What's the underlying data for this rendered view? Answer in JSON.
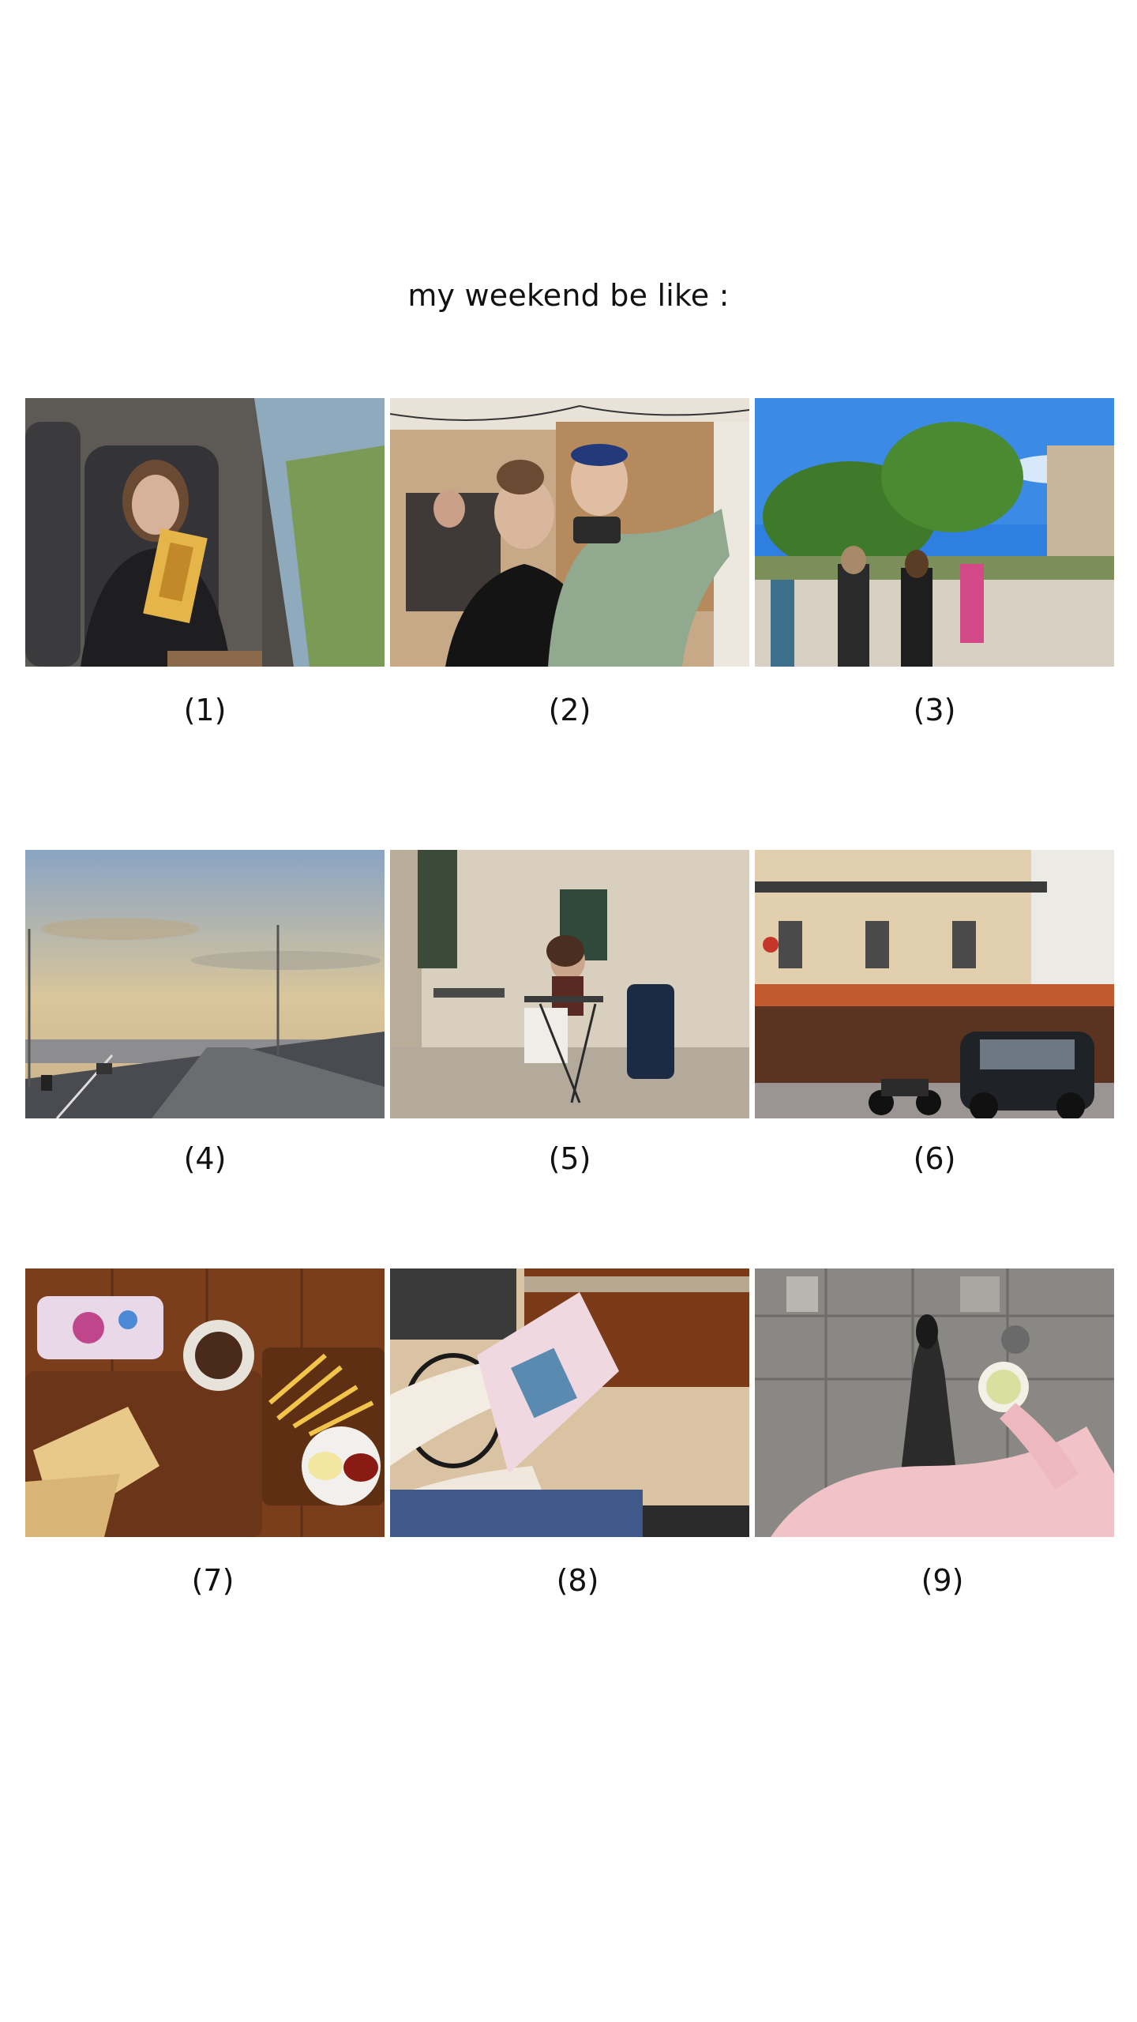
{
  "title": "my weekend be like :",
  "photos": [
    {
      "caption": "(1)",
      "subject": "girl reading a yellow book on a train seat by the window"
    },
    {
      "caption": "(2)",
      "subject": "two girls taking a mirror selfie in a cafe"
    },
    {
      "caption": "(3)",
      "subject": "people walking down a tree-lined street under blue sky"
    },
    {
      "caption": "(4)",
      "subject": "highway with street lamps at sunset"
    },
    {
      "caption": "(5)",
      "subject": "girl sitting at a small outdoor table against a stone wall"
    },
    {
      "caption": "(6)",
      "subject": "Parisian cafe terrace with a scooter and a small black car"
    },
    {
      "caption": "(7)",
      "subject": "sandwich, fries and sauces on a wooden table"
    },
    {
      "caption": "(8)",
      "subject": "hands holding a magazine in a cafe"
    },
    {
      "caption": "(9)",
      "subject": "feet on stone pavement, hand holding a coffee cup, pink sweater"
    }
  ],
  "colors": {
    "background": "#ffffff",
    "text": "#111111"
  }
}
